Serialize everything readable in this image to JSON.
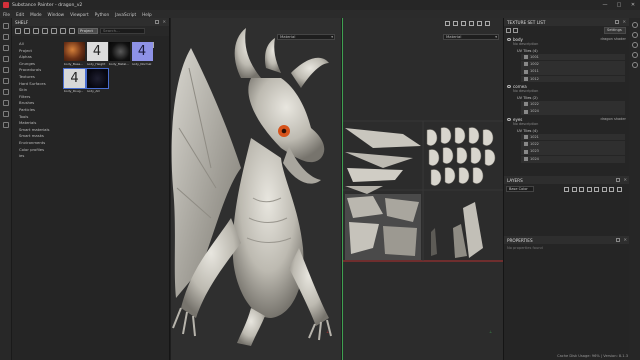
{
  "window": {
    "title": "Substance Painter - dragon_v2",
    "controls": [
      "—",
      "□",
      "✕"
    ]
  },
  "menu": [
    "File",
    "Edit",
    "Mode",
    "Window",
    "Viewport",
    "Python",
    "JavaScript",
    "Help"
  ],
  "shelf": {
    "title": "SHELF",
    "filter_chip": "Project",
    "search_placeholder": "Search...",
    "categories": [
      "All",
      "Project",
      "Alphas",
      "Grunges",
      "Procedurals",
      "Textures",
      "Hard Surfaces",
      "Skin",
      "Filters",
      "Brushes",
      "Particles",
      "Tools",
      "Materials",
      "Smart materials",
      "Smart masks",
      "Environments",
      "Color profiles",
      "ies"
    ],
    "thumbnails": [
      {
        "name": "body_Base...",
        "kind": "basecolor"
      },
      {
        "name": "body_Height",
        "kind": "number",
        "glyph": "4"
      },
      {
        "name": "body_Metal...",
        "kind": "dark"
      },
      {
        "name": "body_Normal",
        "kind": "normal",
        "glyph": "4"
      },
      {
        "name": "body_Roug...",
        "kind": "number",
        "glyph": "4"
      },
      {
        "name": "body_AO",
        "kind": "ao"
      }
    ]
  },
  "viewport3d": {
    "material_label": "Material"
  },
  "viewport2d": {
    "material_label": "Material"
  },
  "texture_set_list": {
    "title": "TEXTURE SET LIST",
    "settings_label": "Settings",
    "sets": [
      {
        "name": "body",
        "shader": "dragon shader",
        "description": "No description",
        "uv_header": "UV Tiles (4)",
        "tiles": [
          "1001",
          "1002",
          "1011",
          "1012"
        ]
      },
      {
        "name": "cornea",
        "shader": "",
        "description": "No description",
        "uv_header": "UV Tiles (2)",
        "tiles": [
          "1022",
          "1024"
        ]
      },
      {
        "name": "eyes",
        "shader": "dragon shader",
        "description": "No description",
        "uv_header": "UV Tiles (4)",
        "tiles": [
          "1021",
          "1022",
          "1023",
          "1024"
        ]
      }
    ]
  },
  "layers": {
    "title": "LAYERS",
    "blend_mode": "Base Color"
  },
  "properties": {
    "title": "PROPERTIES",
    "empty_text": "No properties found"
  },
  "status": {
    "text": "Cache Disk Usage: 96% | Version: 8.1.3"
  },
  "colors": {
    "accent_green": "#3ea050",
    "accent_red": "#c23a3a",
    "selection_blue": "#4a6ed0"
  }
}
